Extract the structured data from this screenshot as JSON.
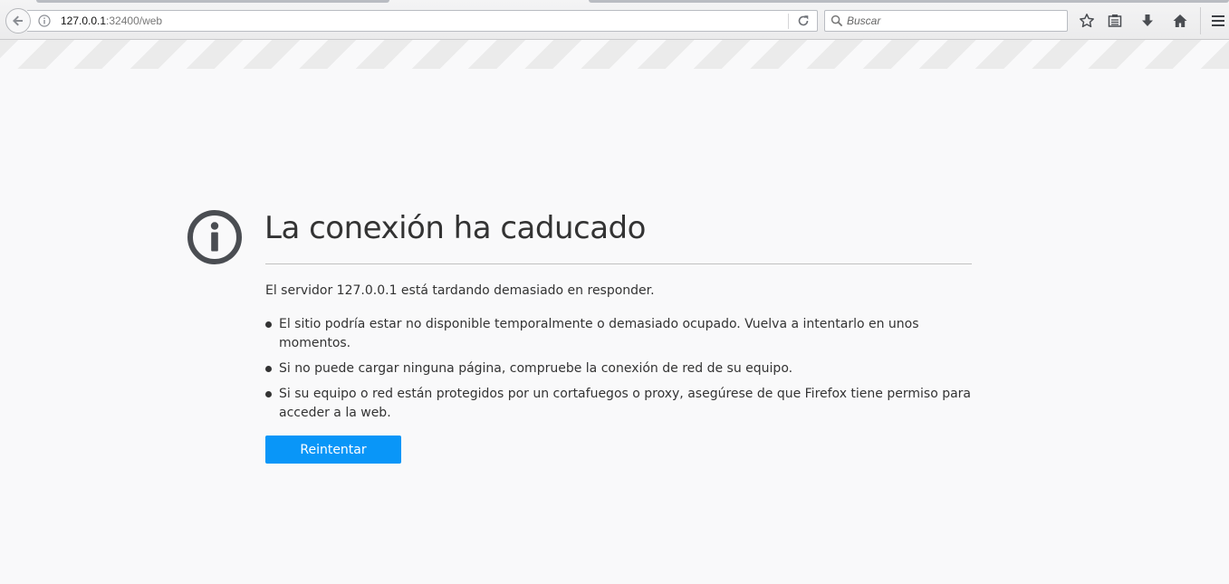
{
  "browser": {
    "url_host": "127.0.0.1",
    "url_rest": ":32400/web",
    "search_placeholder": "Buscar",
    "icons": [
      "back-arrow-icon",
      "site-info-icon",
      "reload-icon",
      "search-icon",
      "bookmark-star-icon",
      "reading-list-icon",
      "download-icon",
      "home-icon",
      "hamburger-menu-icon"
    ]
  },
  "error": {
    "title": "La conexión ha caducado",
    "description": "El servidor 127.0.0.1 está tardando demasiado en responder.",
    "suggestions": [
      "El sitio podría estar no disponible temporalmente o demasiado ocupado. Vuelva a intentarlo en unos momentos.",
      "Si no puede cargar ninguna página, compruebe la conexión de red de su equipo.",
      "Si su equipo o red están protegidos por un cortafuegos o proxy, asegúrese de que Firefox tiene permiso para acceder a la web."
    ],
    "retry_label": "Reintentar"
  },
  "colors": {
    "accent": "#0996f8",
    "text": "#333333",
    "page_background": "#f9f9fa",
    "stripe": "#ebebeb"
  }
}
